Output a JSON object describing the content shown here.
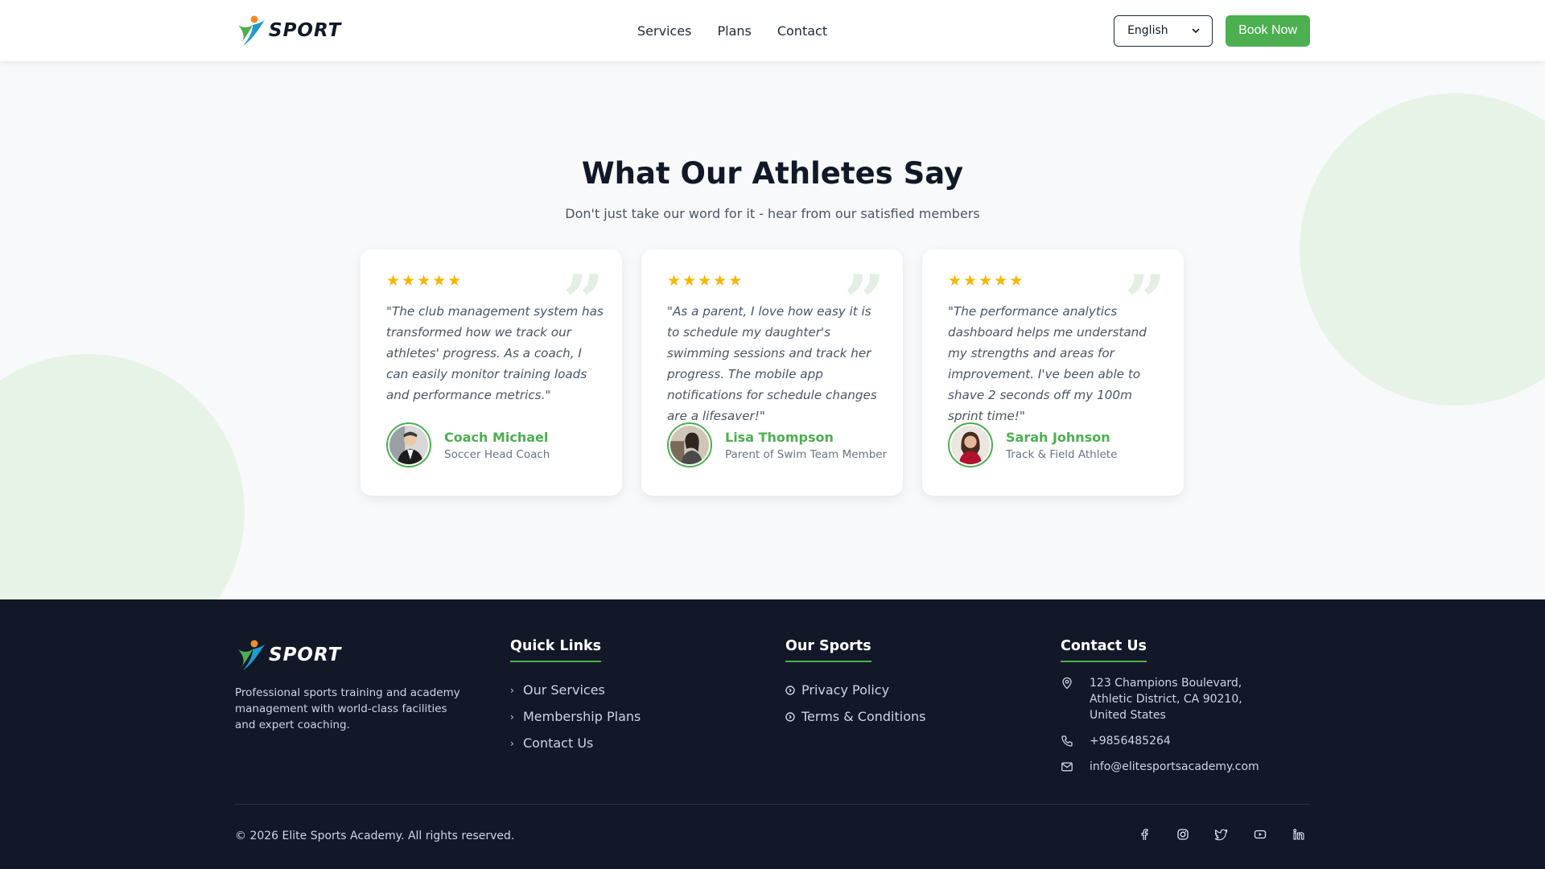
{
  "header": {
    "logo_text": "SPORT",
    "nav": [
      "Services",
      "Plans",
      "Contact"
    ],
    "language": "English",
    "book_label": "Book Now"
  },
  "section": {
    "title": "What Our Athletes Say",
    "subtitle": "Don't just take our word for it - hear from our satisfied members",
    "rating_max": 5,
    "testimonials": [
      {
        "rating": 5,
        "quote": "\"The club management system has transformed how we track our athletes' progress. As a coach, I can easily monitor training loads and performance metrics.\"",
        "name": "Coach Michael",
        "role": "Soccer Head Coach"
      },
      {
        "rating": 5,
        "quote": "\"As a parent, I love how easy it is to schedule my daughter's swimming sessions and track her progress. The mobile app notifications for schedule changes are a lifesaver!\"",
        "name": "Lisa Thompson",
        "role": "Parent of Swim Team Member"
      },
      {
        "rating": 5,
        "quote": "\"The performance analytics dashboard helps me understand my strengths and areas for improvement. I've been able to shave 2 seconds off my 100m sprint time!\"",
        "name": "Sarah Johnson",
        "role": "Track & Field Athlete"
      }
    ]
  },
  "footer": {
    "logo_text": "SPORT",
    "description": "Professional sports training and academy management with world-class facilities and expert coaching.",
    "quick_links_heading": "Quick Links",
    "quick_links": [
      "Our Services",
      "Membership Plans",
      "Contact Us"
    ],
    "sports_heading": "Our Sports",
    "sports_links": [
      "Privacy Policy",
      "Terms & Conditions"
    ],
    "contact_heading": "Contact Us",
    "contact": {
      "address": "123 Champions Boulevard, Athletic District, CA 90210, United States",
      "phone": "+9856485264",
      "email": "info@elitesportsacademy.com"
    },
    "copyright": "© 2026 Elite Sports Academy. All rights reserved.",
    "socials": [
      "facebook-icon",
      "instagram-icon",
      "twitter-icon",
      "youtube-icon",
      "linkedin-icon"
    ]
  },
  "colors": {
    "accent": "#4caf50",
    "footer_bg": "#131828",
    "star": "#f5b700",
    "decor_circle": "#e8f3e8"
  }
}
